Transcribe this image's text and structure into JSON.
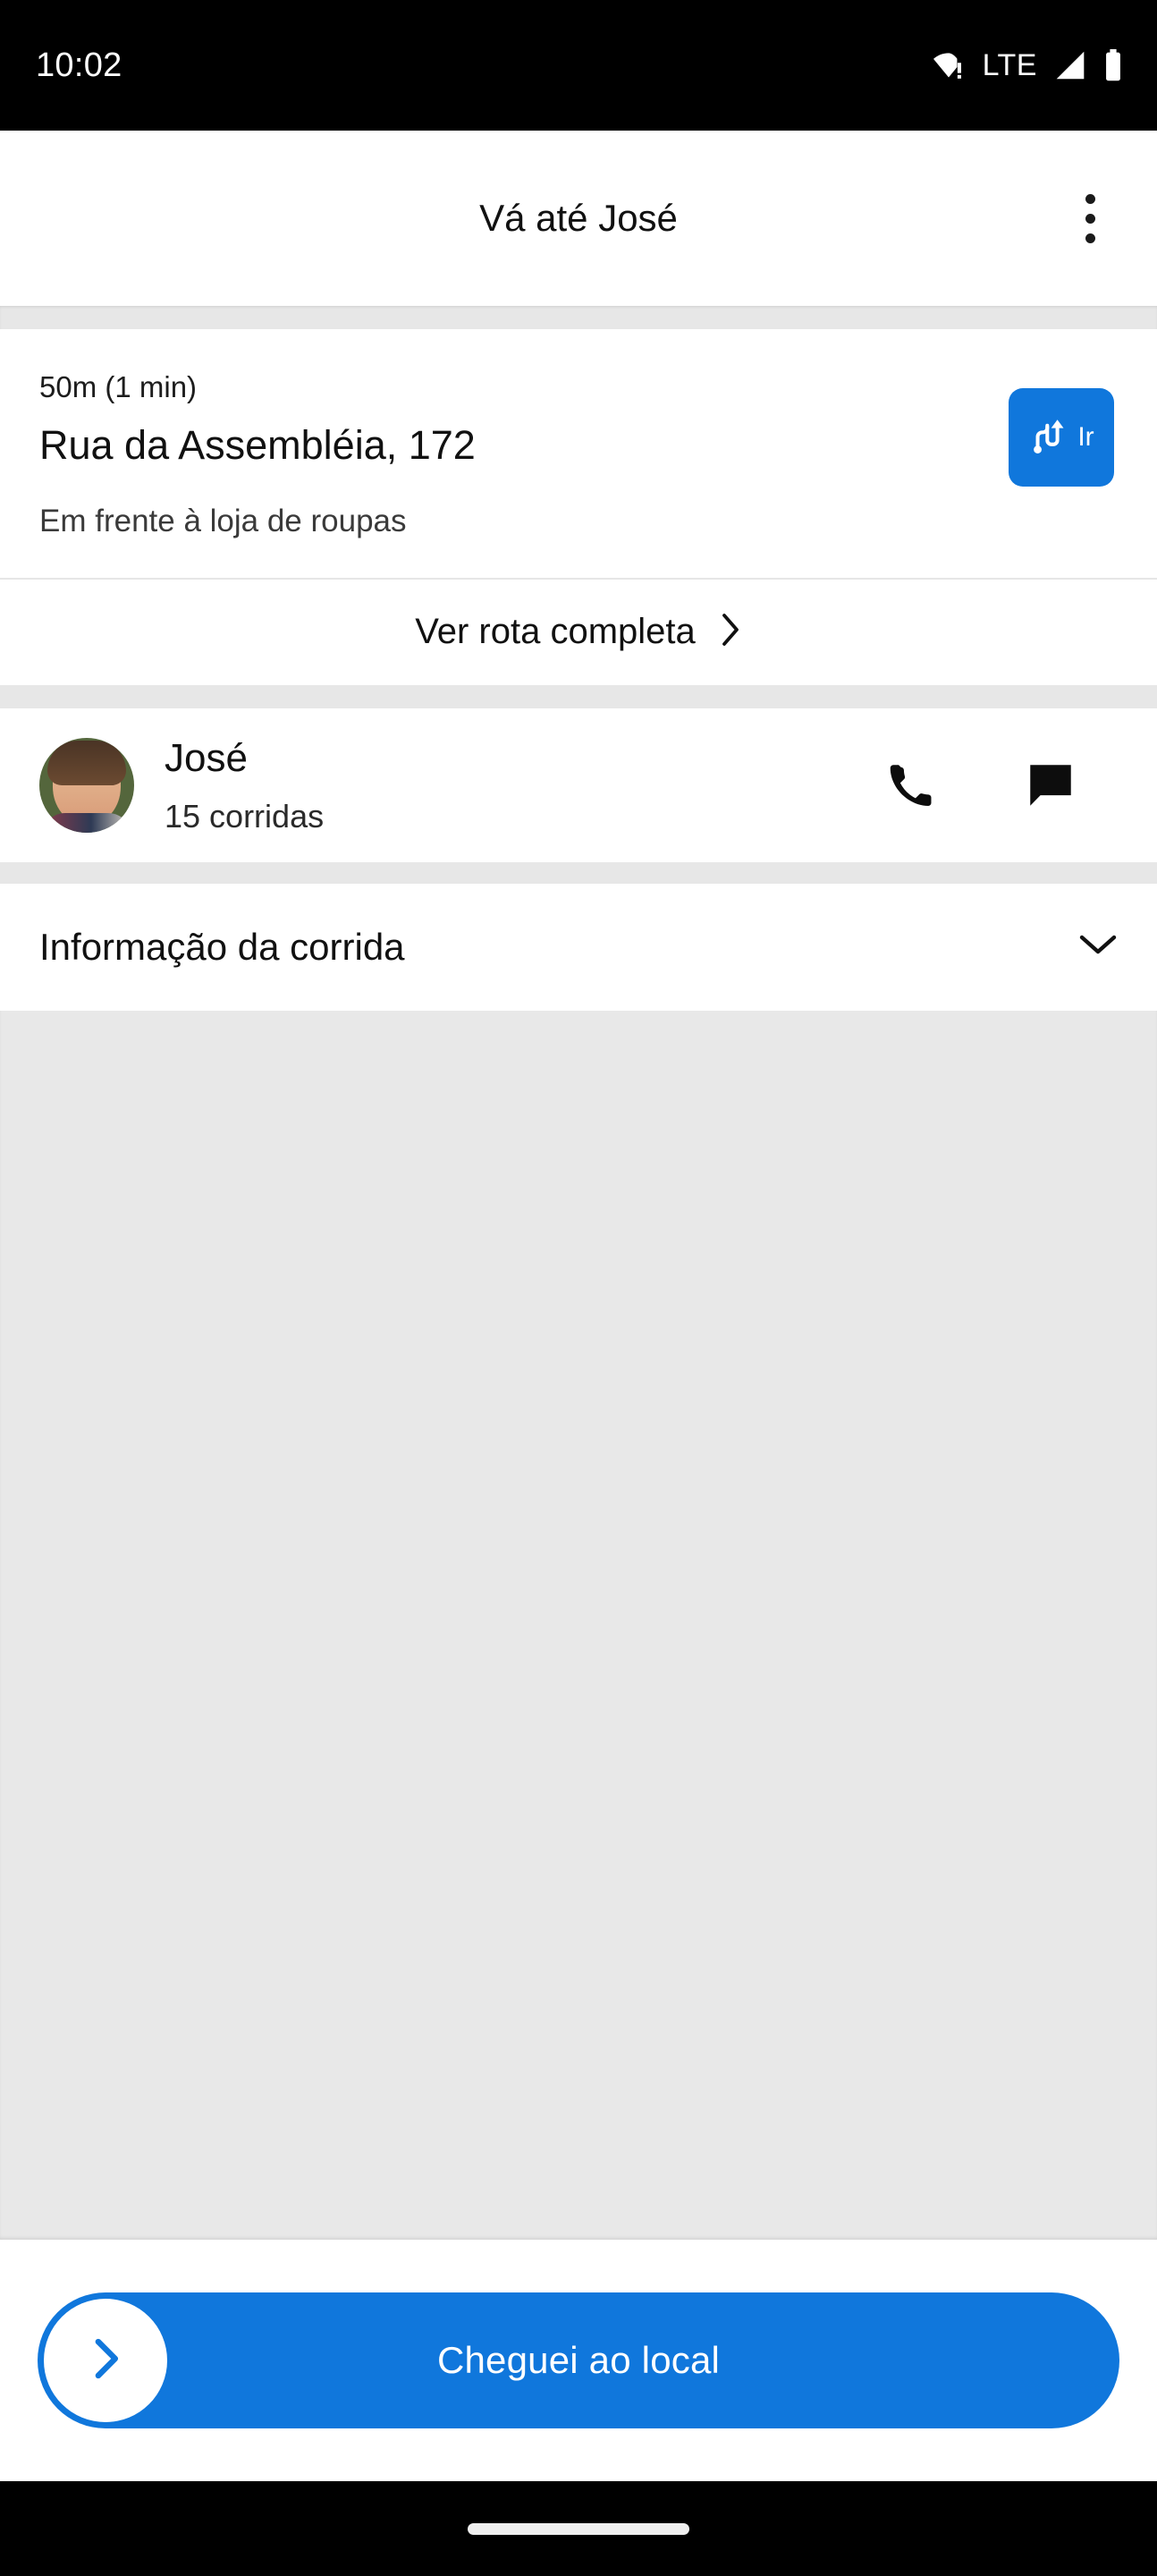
{
  "status_bar": {
    "time": "10:02",
    "network_label": "LTE",
    "icons": [
      "wifi-alert-icon",
      "lte-label",
      "cellular-signal-icon",
      "battery-icon"
    ]
  },
  "app_bar": {
    "title": "Vá até José",
    "overflow_name": "more-options-icon"
  },
  "pickup": {
    "eta": "50m (1 min)",
    "address": "Rua da Assembléia, 172",
    "note": "Em frente à loja de roupas",
    "go_button_label": "Ir",
    "go_button_icon": "route-directions-icon",
    "go_button_color": "#1077dc"
  },
  "route_link": {
    "label": "Ver rota completa",
    "chevron_icon": "chevron-right-icon"
  },
  "passenger": {
    "name": "José",
    "rides": "15 corridas",
    "avatar_name": "passenger-avatar",
    "call_icon": "phone-icon",
    "message_icon": "chat-bubble-icon"
  },
  "ride_info": {
    "label": "Informação da corrida",
    "chevron_icon": "chevron-down-icon"
  },
  "bottom_action": {
    "label": "Cheguei ao local",
    "thumb_icon": "chevron-right-icon",
    "color": "#1077dc"
  },
  "nav_bar": {
    "gesture_pill": "home-gesture-pill"
  }
}
